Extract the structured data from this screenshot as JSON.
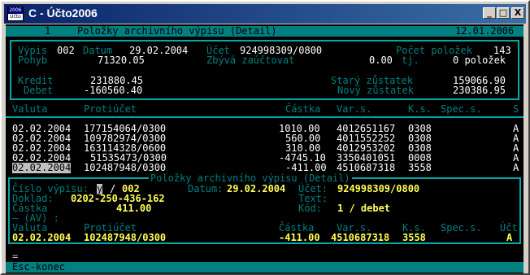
{
  "window": {
    "app_icon_top": "2006",
    "app_icon_bottom": "Účto",
    "title": "C - Účto2006",
    "minimize": "_",
    "maximize": "□",
    "close": "X"
  },
  "header_bar": {
    "number": "1",
    "title": "Položky archivního výpisu (Detail)",
    "date": "12.01.2006"
  },
  "summary": {
    "vypis_label": "Výpis",
    "vypis_value": "002",
    "datum_label": "Datum",
    "datum_value": "29.02.2004",
    "ucet_label": "Účet",
    "ucet_value": "924998309/0800",
    "pocet_label": "Počet položek",
    "pocet_value": "143",
    "pohyb_label": "Pohyb",
    "pohyb_value": "71320.05",
    "zbyva_label": "Zbývá zaúčtovat",
    "zbyva_value": "0.00",
    "tj_label": "tj.",
    "polozek_value": "0 položek",
    "kredit_label": "Kredit",
    "kredit_value": "231880.45",
    "debet_label": "Debet",
    "debet_value": "-160560.40",
    "stary_label": "Starý zůstatek",
    "stary_value": "159066.90",
    "novy_label": "Nový zůstatek",
    "novy_value": "230386.95"
  },
  "table": {
    "headers": {
      "valuta": "Valuta",
      "protiucet": "Protiúčet",
      "castka": "Částka",
      "vars": "Var.s.",
      "ks": "K.s.",
      "specs": "Spec.s.",
      "s": "S"
    },
    "rows": [
      {
        "valuta": "02.02.2004",
        "protiucet": "177154064/0300",
        "castka": "1010.00",
        "vars": "4012651167",
        "ks": "0308",
        "specs": "",
        "s": "A"
      },
      {
        "valuta": "02.02.2004",
        "protiucet": "109782974/0300",
        "castka": "560.00",
        "vars": "4011552252",
        "ks": "0308",
        "specs": "",
        "s": "A"
      },
      {
        "valuta": "02.02.2004",
        "protiucet": "163114328/0600",
        "castka": "310.00",
        "vars": "4012953202",
        "ks": "0308",
        "specs": "",
        "s": "A"
      },
      {
        "valuta": "02.02.2004",
        "protiucet": "51535473/0300",
        "castka": "-4745.10",
        "vars": "3350401051",
        "ks": "0008",
        "specs": "",
        "s": "A"
      },
      {
        "valuta": "02.02.2004",
        "protiucet": "102487948/0300",
        "castka": "-411.00",
        "vars": "4510687318",
        "ks": "3558",
        "specs": "",
        "s": "A"
      }
    ]
  },
  "detail": {
    "title": "Položky archivního výpisu (Detail)",
    "cislo_label": "Číslo výpisu:",
    "cislo_cursor": "y",
    "cislo_sep": "/",
    "cislo_value": "002",
    "datum_label": "Datum:",
    "datum_value": "29.02.2004",
    "ucet_label": "Účet:",
    "ucet_value": "924998309/0800",
    "doklad_label": "Doklad:",
    "doklad_value": "0202-250-436-162",
    "text_label": "Text:",
    "castka_label": "Částka",
    "castka_value": "411.00",
    "kod_label": "Kód:",
    "kod_value": "1 / debet",
    "av_label": "— (AV) :",
    "headers": {
      "valuta": "Valuta",
      "protiucet": "Protiúčet",
      "castka": "Částka",
      "vars": "Var.s.",
      "ks": "K.s.",
      "specs": "Spec.s.",
      "ucet": "Účt"
    },
    "row": {
      "valuta": "02.02.2004",
      "protiucet": "102487948/0300",
      "castka": "-411.00",
      "vars": "4510687318",
      "ks": "3558",
      "specs": "",
      "ucet": "A"
    }
  },
  "status": {
    "line": "=",
    "hint": "Esc-konec"
  }
}
